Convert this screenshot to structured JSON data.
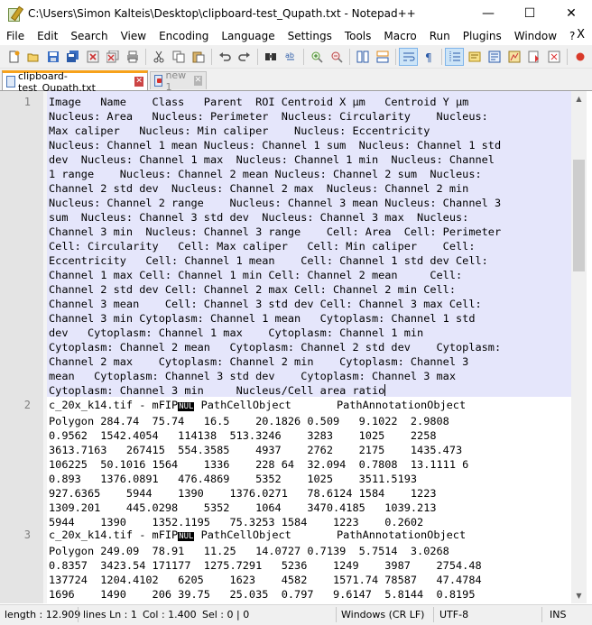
{
  "window": {
    "title": "C:\\Users\\Simon Kalteis\\Desktop\\clipboard-test_Qupath.txt - Notepad++",
    "minimize": "—",
    "maximize": "☐",
    "close": "✕"
  },
  "menu": {
    "items": [
      "File",
      "Edit",
      "Search",
      "View",
      "Encoding",
      "Language",
      "Settings",
      "Tools",
      "Macro",
      "Run",
      "Plugins",
      "Window",
      "?"
    ],
    "close_doc": "X"
  },
  "tabs": [
    {
      "label": "clipboard-test_Qupath.txt",
      "close": "✕",
      "active": true
    },
    {
      "label": "new 1",
      "close": "✕",
      "active": false
    }
  ],
  "gutter": {
    "line1": "1",
    "line2": "2",
    "line3": "3"
  },
  "editor": {
    "line1_text": "Image   Name    Class   Parent  ROI Centroid X µm   Centroid Y µm\nNucleus: Area   Nucleus: Perimeter  Nucleus: Circularity    Nucleus:\nMax caliper   Nucleus: Min caliper    Nucleus: Eccentricity\nNucleus: Channel 1 mean Nucleus: Channel 1 sum  Nucleus: Channel 1 std\ndev  Nucleus: Channel 1 max  Nucleus: Channel 1 min  Nucleus: Channel\n1 range    Nucleus: Channel 2 mean Nucleus: Channel 2 sum  Nucleus:\nChannel 2 std dev  Nucleus: Channel 2 max  Nucleus: Channel 2 min\nNucleus: Channel 2 range    Nucleus: Channel 3 mean Nucleus: Channel 3\nsum  Nucleus: Channel 3 std dev  Nucleus: Channel 3 max  Nucleus:\nChannel 3 min  Nucleus: Channel 3 range    Cell: Area  Cell: Perimeter\nCell: Circularity   Cell: Max caliper   Cell: Min caliper    Cell:\nEccentricity   Cell: Channel 1 mean    Cell: Channel 1 std dev Cell:\nChannel 1 max Cell: Channel 1 min Cell: Channel 2 mean     Cell:\nChannel 2 std dev Cell: Channel 2 max Cell: Channel 2 min Cell:\nChannel 3 mean    Cell: Channel 3 std dev Cell: Channel 3 max Cell:\nChannel 3 min Cytoplasm: Channel 1 mean   Cytoplasm: Channel 1 std\ndev   Cytoplasm: Channel 1 max    Cytoplasm: Channel 1 min\nCytoplasm: Channel 2 mean   Cytoplasm: Channel 2 std dev    Cytoplasm:\nChannel 2 max    Cytoplasm: Channel 2 min    Cytoplasm: Channel 3\nmean   Cytoplasm: Channel 3 std dev    Cytoplasm: Channel 3 max\nCytoplasm: Channel 3 min     Nucleus/Cell area ratio",
    "line2_head": "c_20x_k14.tif - mFIP",
    "line2_nul": "NUL",
    "line2_tail": " PathCellObject       PathAnnotationObject",
    "line2_rest": "Polygon 284.74  75.74   16.5    20.1826 0.509   9.1022  2.9808\n0.9562  1542.4054   114138  513.3246    3283    1025    2258\n3613.7163   267415  554.3585    4937    2762    2175    1435.473\n106225  50.1016 1564    1336    228 64  32.094  0.7808  13.1111 6\n0.893   1376.0891   476.4869    5352    1025    3511.5193\n927.6365    5944    1390    1376.0271   78.6124 1584    1223\n1309.201    445.0298    5352    1064    3470.4185   1039.213\n5944    1390    1352.1195   75.3253 1584    1223    0.2602",
    "line3_head": "c_20x_k14.tif - mFIP",
    "line3_nul": "NUL",
    "line3_tail": " PathCellObject       PathAnnotationObject",
    "line3_rest": "Polygon 249.09  78.91   11.25   14.0727 0.7139  5.7514  3.0268\n0.8357  3423.54 171177  1275.7291   5236    1249    3987    2754.48\n137724  1204.4102   6205    1623    4582    1571.74 78587   47.4784\n1696    1490    206 39.75   25.035  0.797   9.6147  5.8144  0.8195"
  },
  "status": {
    "length": "length : 12.909",
    "lines": "lines  Ln : 1",
    "col": "Col : 1.400",
    "sel": "Sel : 0 | 0",
    "eol": "Windows (CR LF)",
    "encoding": "UTF-8",
    "mode": "INS"
  },
  "colors": {
    "selection": "#e5e6fb",
    "active_tab_accent": "#f7a21b"
  }
}
